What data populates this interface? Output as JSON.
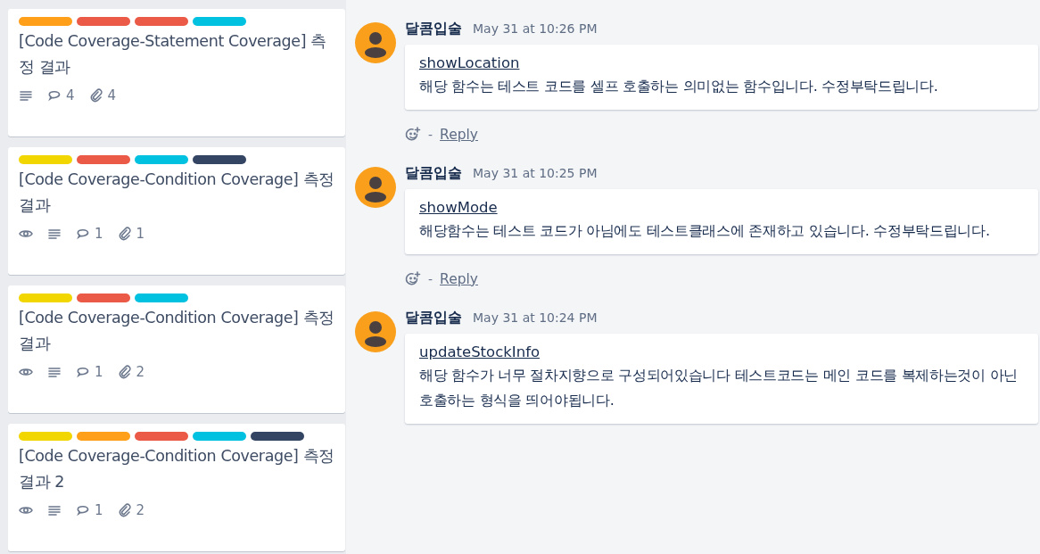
{
  "cards": [
    {
      "labels": [
        {
          "color": "#ff9f1a"
        },
        {
          "color": "#eb5a46"
        },
        {
          "color": "#eb5a46"
        },
        {
          "color": "#00c2e0"
        }
      ],
      "title": "[Code Coverage-Statement Coverage] 측정 결과",
      "badges": [
        {
          "kind": "description"
        },
        {
          "kind": "comments",
          "count": "4"
        },
        {
          "kind": "attachments",
          "count": "4"
        }
      ]
    },
    {
      "labels": [
        {
          "color": "#f2d600"
        },
        {
          "color": "#eb5a46"
        },
        {
          "color": "#00c2e0"
        },
        {
          "color": "#344563"
        }
      ],
      "title": "[Code Coverage-Condition Coverage] 측정 결과",
      "badges": [
        {
          "kind": "watching"
        },
        {
          "kind": "description"
        },
        {
          "kind": "comments",
          "count": "1"
        },
        {
          "kind": "attachments",
          "count": "1"
        }
      ]
    },
    {
      "labels": [
        {
          "color": "#f2d600"
        },
        {
          "color": "#eb5a46"
        },
        {
          "color": "#00c2e0"
        }
      ],
      "title": "[Code Coverage-Condition Coverage] 측정 결과",
      "badges": [
        {
          "kind": "watching"
        },
        {
          "kind": "description"
        },
        {
          "kind": "comments",
          "count": "1"
        },
        {
          "kind": "attachments",
          "count": "2"
        }
      ]
    },
    {
      "labels": [
        {
          "color": "#f2d600"
        },
        {
          "color": "#ff9f1a"
        },
        {
          "color": "#eb5a46"
        },
        {
          "color": "#00c2e0"
        },
        {
          "color": "#344563"
        }
      ],
      "title": "[Code Coverage-Condition Coverage] 측정 결과 2",
      "badges": [
        {
          "kind": "watching"
        },
        {
          "kind": "description"
        },
        {
          "kind": "comments",
          "count": "1"
        },
        {
          "kind": "attachments",
          "count": "2"
        }
      ]
    }
  ],
  "comments": [
    {
      "author": "달콤입술",
      "time": "May 31 at 10:26 PM",
      "link": "showLocation",
      "body": "해당 함수는 테스트 코드를 셀프 호출하는 의미없는 함수입니다. 수정부탁드립니다.",
      "separator": "-",
      "reply": "Reply"
    },
    {
      "author": "달콤입술",
      "time": "May 31 at 10:25 PM",
      "link": "showMode",
      "body": "해당함수는 테스트 코드가 아님에도 테스트클래스에 존재하고 있습니다. 수정부탁드립니다.",
      "separator": "-",
      "reply": "Reply"
    },
    {
      "author": "달콤입술",
      "time": "May 31 at 10:24 PM",
      "link": "updateStockInfo",
      "body": "해당 함수가 너무 절차지향으로 구성되어있습니다 테스트코드는 메인 코드를 복제하는것이 아닌 호출하는 형식을 띄어야됩니다."
    }
  ]
}
